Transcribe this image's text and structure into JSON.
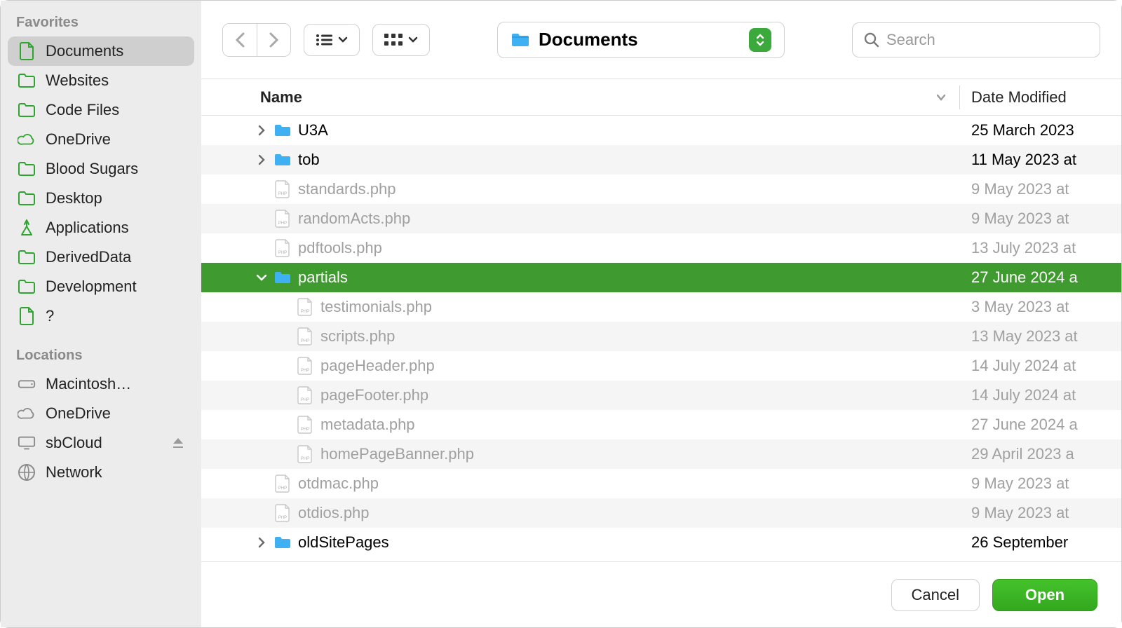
{
  "sidebar": {
    "sections": [
      {
        "title": "Favorites",
        "items": [
          {
            "icon": "doc",
            "label": "Documents",
            "selected": true
          },
          {
            "icon": "folder",
            "label": "Websites"
          },
          {
            "icon": "folder",
            "label": "Code Files"
          },
          {
            "icon": "cloud",
            "label": "OneDrive"
          },
          {
            "icon": "folder",
            "label": "Blood Sugars"
          },
          {
            "icon": "folder",
            "label": "Desktop"
          },
          {
            "icon": "apps",
            "label": "Applications"
          },
          {
            "icon": "folder",
            "label": "DerivedData"
          },
          {
            "icon": "folder",
            "label": "Development"
          },
          {
            "icon": "doc",
            "label": "?"
          }
        ]
      },
      {
        "title": "Locations",
        "items": [
          {
            "icon": "disk",
            "label": "Macintosh…"
          },
          {
            "icon": "cloud-g",
            "label": "OneDrive"
          },
          {
            "icon": "display",
            "label": "sbCloud",
            "eject": true
          },
          {
            "icon": "globe",
            "label": "Network"
          }
        ]
      }
    ]
  },
  "toolbar": {
    "path_label": "Documents",
    "search_placeholder": "Search"
  },
  "columns": {
    "name": "Name",
    "date": "Date Modified"
  },
  "rows": [
    {
      "indent": 1,
      "disc": "right",
      "type": "folder",
      "name": "U3A",
      "date": "25 March 2023",
      "dim": false,
      "selected": false
    },
    {
      "indent": 1,
      "disc": "right",
      "type": "folder",
      "name": "tob",
      "date": "11 May 2023 at",
      "dim": false,
      "selected": false
    },
    {
      "indent": 1,
      "disc": "",
      "type": "php",
      "name": "standards.php",
      "date": "9 May 2023 at",
      "dim": true
    },
    {
      "indent": 1,
      "disc": "",
      "type": "php",
      "name": "randomActs.php",
      "date": "9 May 2023 at",
      "dim": true
    },
    {
      "indent": 1,
      "disc": "",
      "type": "php",
      "name": "pdftools.php",
      "date": "13 July 2023 at",
      "dim": true
    },
    {
      "indent": 1,
      "disc": "down",
      "type": "folder",
      "name": "partials",
      "date": "27 June 2024 a",
      "dim": false,
      "selected": true
    },
    {
      "indent": 2,
      "disc": "",
      "type": "php",
      "name": "testimonials.php",
      "date": "3 May 2023 at",
      "dim": true
    },
    {
      "indent": 2,
      "disc": "",
      "type": "php",
      "name": "scripts.php",
      "date": "13 May 2023 at",
      "dim": true
    },
    {
      "indent": 2,
      "disc": "",
      "type": "php",
      "name": "pageHeader.php",
      "date": "14 July 2024 at",
      "dim": true
    },
    {
      "indent": 2,
      "disc": "",
      "type": "php",
      "name": "pageFooter.php",
      "date": "14 July 2024 at",
      "dim": true
    },
    {
      "indent": 2,
      "disc": "",
      "type": "php",
      "name": "metadata.php",
      "date": "27 June 2024 a",
      "dim": true
    },
    {
      "indent": 2,
      "disc": "",
      "type": "php",
      "name": "homePageBanner.php",
      "date": "29 April 2023 a",
      "dim": true
    },
    {
      "indent": 1,
      "disc": "",
      "type": "php",
      "name": "otdmac.php",
      "date": "9 May 2023 at",
      "dim": true
    },
    {
      "indent": 1,
      "disc": "",
      "type": "php",
      "name": "otdios.php",
      "date": "9 May 2023 at",
      "dim": true
    },
    {
      "indent": 1,
      "disc": "right",
      "type": "folder",
      "name": "oldSitePages",
      "date": "26 September",
      "dim": false
    }
  ],
  "footer": {
    "cancel": "Cancel",
    "open": "Open"
  }
}
